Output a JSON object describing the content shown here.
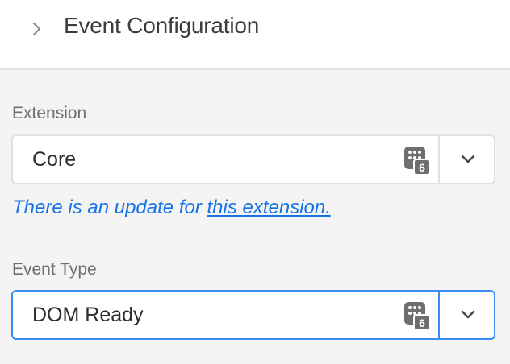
{
  "header": {
    "title": "Event Configuration"
  },
  "extension_field": {
    "label": "Extension",
    "value": "Core",
    "badge_number": "6"
  },
  "update_note": {
    "prefix": "There is an update for ",
    "link_text": "this extension."
  },
  "event_type_field": {
    "label": "Event Type",
    "value": "DOM Ready",
    "badge_number": "6"
  },
  "colors": {
    "link": "#1473e6",
    "focus_border": "#378ef0",
    "badge_fill": "#6e6e6e"
  }
}
